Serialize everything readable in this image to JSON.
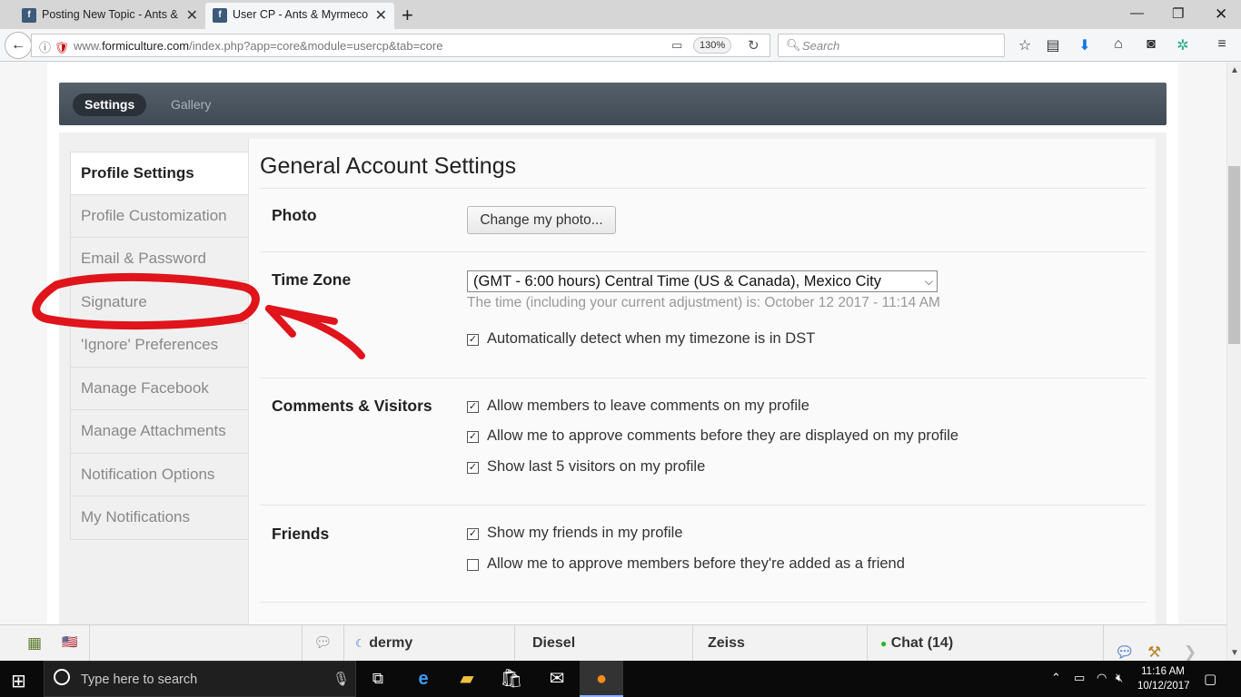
{
  "browser": {
    "tabs": [
      {
        "title": "Posting New Topic - Ants &",
        "active": false
      },
      {
        "title": "User CP - Ants & Myrmecol",
        "active": true
      }
    ],
    "url_prefix": "www.",
    "url_domain": "formiculture.com",
    "url_path": "/index.php?app=core&module=usercp&tab=core",
    "zoom": "130%",
    "search_placeholder": "Search"
  },
  "site_nav": {
    "tabs": [
      "Settings",
      "Gallery"
    ],
    "active": "Settings"
  },
  "sidebar": {
    "items": [
      {
        "label": "Profile Settings",
        "active": true
      },
      {
        "label": "Profile Customization",
        "active": false
      },
      {
        "label": "Email & Password",
        "active": false
      },
      {
        "label": "Signature",
        "active": false
      },
      {
        "label": "'Ignore' Preferences",
        "active": false
      },
      {
        "label": "Manage Facebook",
        "active": false
      },
      {
        "label": "Manage Attachments",
        "active": false
      },
      {
        "label": "Notification Options",
        "active": false
      },
      {
        "label": "My Notifications",
        "active": false
      }
    ]
  },
  "panel": {
    "title": "General Account Settings",
    "photo": {
      "label": "Photo",
      "button": "Change my photo..."
    },
    "timezone": {
      "label": "Time Zone",
      "selected": "(GMT - 6:00 hours) Central Time (US & Canada), Mexico City",
      "note": "The time (including your current adjustment) is: October 12 2017 - 11:14 AM",
      "dst_label": "Automatically detect when my timezone is in DST",
      "dst_checked": true
    },
    "comments": {
      "label": "Comments & Visitors",
      "options": [
        {
          "label": "Allow members to leave comments on my profile",
          "checked": true
        },
        {
          "label": "Allow me to approve comments before they are displayed on my profile",
          "checked": true
        },
        {
          "label": "Show last 5 visitors on my profile",
          "checked": true
        }
      ]
    },
    "friends": {
      "label": "Friends",
      "options": [
        {
          "label": "Show my friends in my profile",
          "checked": true
        },
        {
          "label": "Allow me to approve members before they're added as a friend",
          "checked": false
        }
      ]
    }
  },
  "chatbar": {
    "users": [
      "dermy",
      "Diesel",
      "Zeiss"
    ],
    "chat_label": "Chat (14)",
    "online_color": "#2bb52b"
  },
  "taskbar": {
    "search_placeholder": "Type here to search",
    "time": "11:16 AM",
    "date": "10/12/2017"
  },
  "colors": {
    "annotation": "#e0141b",
    "nav_bar": "#47525c"
  }
}
